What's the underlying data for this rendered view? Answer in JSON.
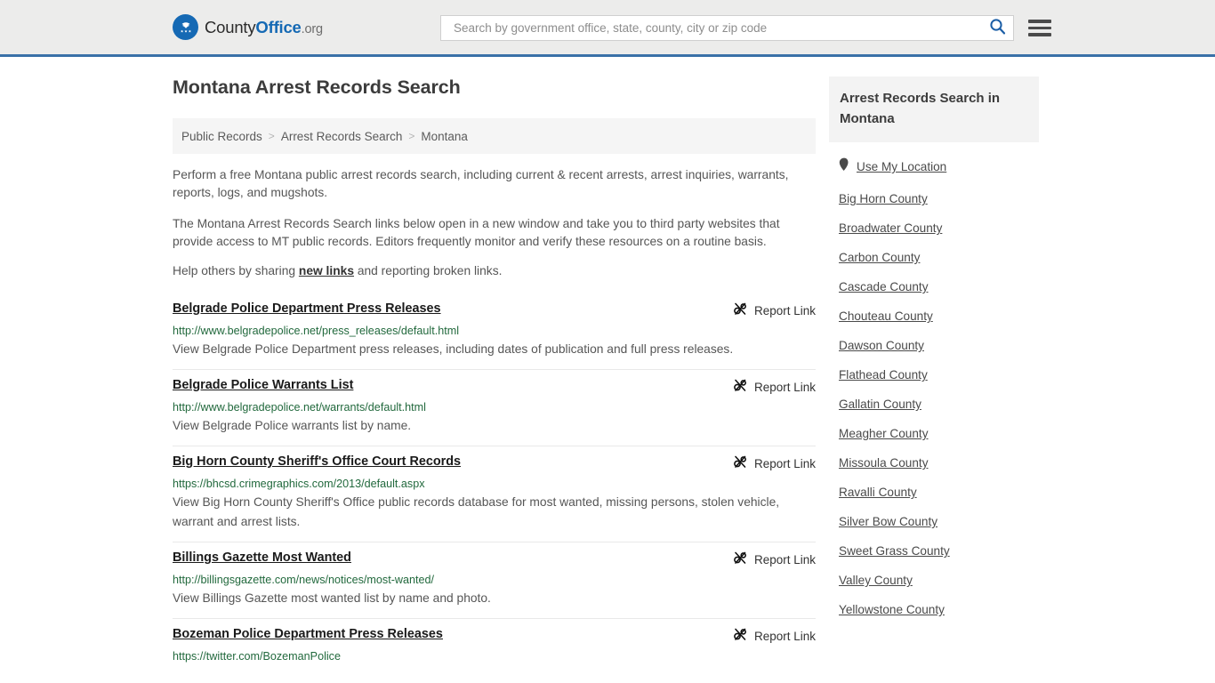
{
  "header": {
    "logo": {
      "part1": "County",
      "part2": "Office",
      "part3": ".org",
      "icon": "eagle-seal-icon"
    },
    "search": {
      "placeholder": "Search by government office, state, county, city or zip code",
      "value": ""
    },
    "search_icon": "search-icon",
    "menu_icon": "hamburger-menu-icon",
    "accent_color": "#3a71a8"
  },
  "page_title": "Montana Arrest Records Search",
  "breadcrumb": {
    "items": [
      {
        "label": "Public Records"
      },
      {
        "label": "Arrest Records Search"
      },
      {
        "label": "Montana"
      }
    ],
    "separator": ">"
  },
  "intro": {
    "p1": "Perform a free Montana public arrest records search, including current & recent arrests, arrest inquiries, warrants, reports, logs, and mugshots.",
    "p2": "The Montana Arrest Records Search links below open in a new window and take you to third party websites that provide access to MT public records. Editors frequently monitor and verify these resources on a routine basis.",
    "p3_before": "Help others by sharing ",
    "p3_link": "new links",
    "p3_after": " and reporting broken links."
  },
  "results": {
    "report_label": "Report Link",
    "report_icon": "broken-link-icon",
    "items": [
      {
        "title": "Belgrade Police Department Press Releases",
        "url": "http://www.belgradepolice.net/press_releases/default.html",
        "description": "View Belgrade Police Department press releases, including dates of publication and full press releases."
      },
      {
        "title": "Belgrade Police Warrants List",
        "url": "http://www.belgradepolice.net/warrants/default.html",
        "description": "View Belgrade Police warrants list by name."
      },
      {
        "title": "Big Horn County Sheriff's Office Court Records",
        "url": "https://bhcsd.crimegraphics.com/2013/default.aspx",
        "description": "View Big Horn County Sheriff's Office public records database for most wanted, missing persons, stolen vehicle, warrant and arrest lists."
      },
      {
        "title": "Billings Gazette Most Wanted",
        "url": "http://billingsgazette.com/news/notices/most-wanted/",
        "description": "View Billings Gazette most wanted list by name and photo."
      },
      {
        "title": "Bozeman Police Department Press Releases",
        "url": "https://twitter.com/BozemanPolice",
        "description": ""
      }
    ]
  },
  "sidebar": {
    "heading": "Arrest Records Search in Montana",
    "use_my_location": {
      "label": "Use My Location",
      "icon": "map-pin-icon"
    },
    "counties": [
      {
        "label": "Big Horn County"
      },
      {
        "label": "Broadwater County"
      },
      {
        "label": "Carbon County"
      },
      {
        "label": "Cascade County"
      },
      {
        "label": "Chouteau County"
      },
      {
        "label": "Dawson County"
      },
      {
        "label": "Flathead County"
      },
      {
        "label": "Gallatin County"
      },
      {
        "label": "Meagher County"
      },
      {
        "label": "Missoula County"
      },
      {
        "label": "Ravalli County"
      },
      {
        "label": "Silver Bow County"
      },
      {
        "label": "Sweet Grass County"
      },
      {
        "label": "Valley County"
      },
      {
        "label": "Yellowstone County"
      }
    ]
  }
}
